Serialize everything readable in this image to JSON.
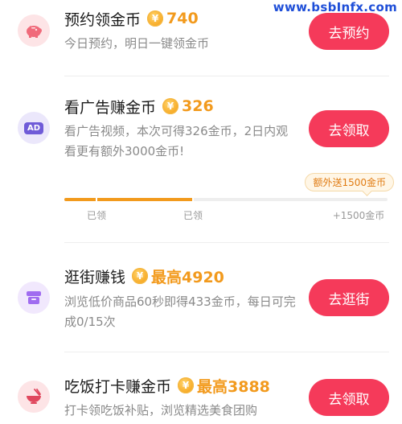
{
  "watermark": "www.bsbInfx.com",
  "tasks": [
    {
      "title": "预约领金币",
      "coin_symbol": "¥",
      "reward": "740",
      "desc": "今日预约，明日一键领金币",
      "button": "去预约",
      "icon": "piggy-bank-icon"
    },
    {
      "title": "看广告赚金币",
      "coin_symbol": "¥",
      "reward": "326",
      "desc": "看广告视频，本次可得326金币，2日内观看更有额外3000金币!",
      "button": "去领取",
      "icon": "ad-icon",
      "icon_text": "AD",
      "progress": {
        "tip": "额外送1500金币",
        "fraction": 0.4,
        "milestones": [
          "已领",
          "已领",
          "+1500金币"
        ]
      }
    },
    {
      "title": "逛街赚钱",
      "coin_symbol": "¥",
      "reward": "最高4920",
      "desc": "浏览低价商品60秒即得433金币，每日可完成0/15次",
      "button": "去逛街",
      "icon": "shop-icon"
    },
    {
      "title": "吃饭打卡赚金币",
      "coin_symbol": "¥",
      "reward": "最高3888",
      "desc": "打卡领吃饭补贴，浏览精选美食团购",
      "button": "去领取",
      "icon": "bowl-icon"
    }
  ],
  "colors": {
    "accent_button": "#f53a5a",
    "reward_orange": "#f29a1d",
    "ad_purple": "#6f5bd8",
    "shop_purple": "#a06cf0",
    "pink_icon": "#f06a7a"
  }
}
